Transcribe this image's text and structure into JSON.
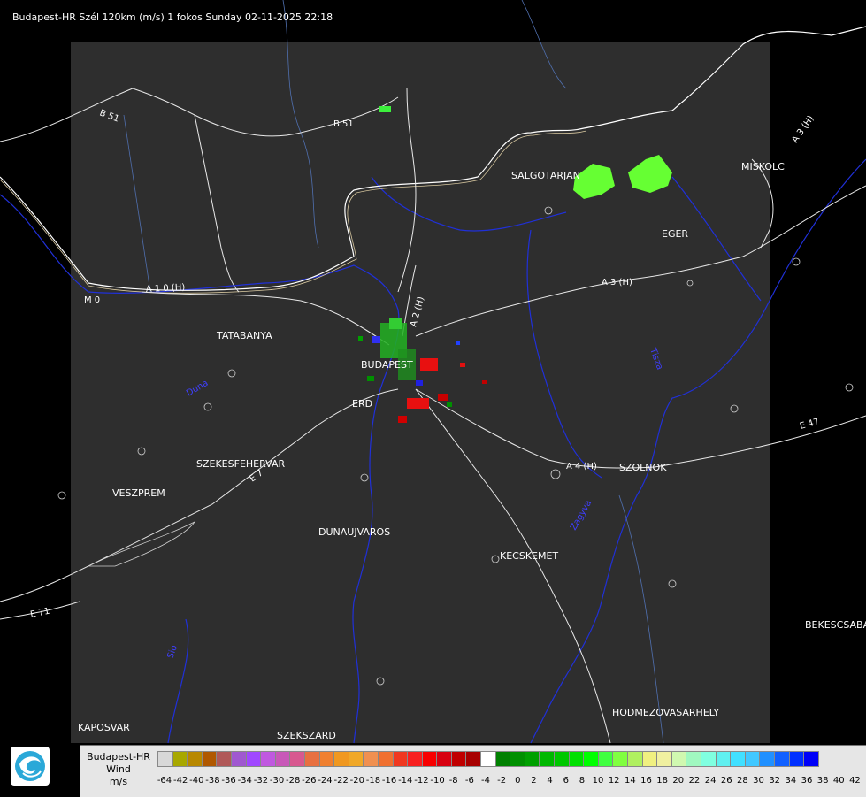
{
  "title": "Budapest-HR Szél 120km (m/s) 1 fokos Sunday 02-11-2025 22:18",
  "cities": [
    "BUDAPEST",
    "TATABANYA",
    "ERD",
    "SZEKESFEHERVAR",
    "VESZPREM",
    "DUNAUJVAROS",
    "KECSKEMET",
    "SZOLNOK",
    "EGER",
    "SALGOTARJAN",
    "MISKOLC",
    "BEKESCSABA",
    "HODMEZOVASARHELY",
    "KAPOSVAR",
    "SZEKSZARD"
  ],
  "roads": [
    "B 51",
    "B 51",
    "A 3 (H)",
    "A 3 (H)",
    "A 4 (H)",
    "E 47",
    "E 71",
    "A 1 0 (H)",
    "M 0",
    "E 7",
    "A 2 (H)"
  ],
  "rivers": [
    "Duna",
    "Tisza",
    "Sio",
    "Zagyva"
  ],
  "legend": {
    "line1": "Budapest-HR",
    "line2": "Wind",
    "line3": "m/s",
    "colors": [
      "#d8d8d8",
      "#a8a800",
      "#b88800",
      "#b05800",
      "#b05858",
      "#a058d0",
      "#a048ff",
      "#c058e0",
      "#c858b8",
      "#d85890",
      "#e87040",
      "#f08030",
      "#f09820",
      "#f0a828",
      "#f09050",
      "#f07030",
      "#f03820",
      "#f82020",
      "#f80000",
      "#d80010",
      "#c00000",
      "#a80000",
      "#ffffff",
      "#008000",
      "#009000",
      "#00a000",
      "#00b800",
      "#00c800",
      "#00e000",
      "#00ff00",
      "#40ff40",
      "#80ff40",
      "#b0f060",
      "#f0f080",
      "#f0f0a0",
      "#d0f8b0",
      "#a0f8c0",
      "#80ffe0",
      "#60f0f0",
      "#40e0ff",
      "#40c8ff",
      "#2090ff",
      "#1060ff",
      "#0030ff",
      "#0000f8"
    ],
    "ticks": [
      "-64",
      "-42",
      "-40",
      "-38",
      "-36",
      "-34",
      "-32",
      "-30",
      "-28",
      "-26",
      "-24",
      "-22",
      "-20",
      "-18",
      "-16",
      "-14",
      "-12",
      "-10",
      "-8",
      "-6",
      "-4",
      "-2",
      "0",
      "2",
      "4",
      "6",
      "8",
      "10",
      "12",
      "14",
      "16",
      "18",
      "20",
      "22",
      "24",
      "26",
      "28",
      "30",
      "32",
      "34",
      "36",
      "38",
      "40",
      "42"
    ]
  }
}
